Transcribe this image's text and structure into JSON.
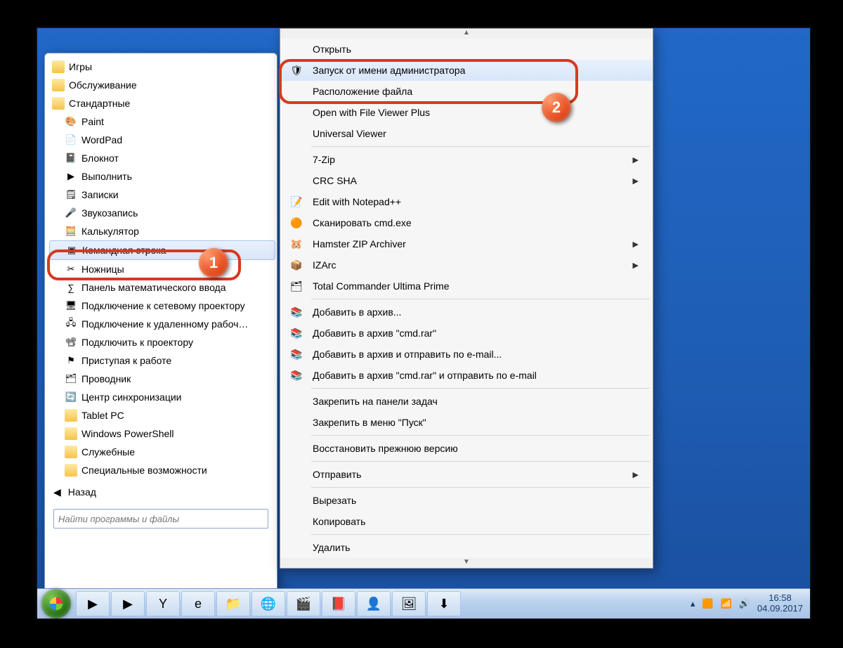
{
  "start_menu": {
    "folders": [
      "Игры",
      "Обслуживание",
      "Стандартные"
    ],
    "programs": [
      {
        "label": "Paint",
        "icon": "🎨"
      },
      {
        "label": "WordPad",
        "icon": "📄"
      },
      {
        "label": "Блокнот",
        "icon": "📓"
      },
      {
        "label": "Выполнить",
        "icon": "▶"
      },
      {
        "label": "Записки",
        "icon": "🗒"
      },
      {
        "label": "Звукозапись",
        "icon": "🎤"
      },
      {
        "label": "Калькулятор",
        "icon": "🧮"
      },
      {
        "label": "Командная строка",
        "icon": "▣",
        "selected": true
      },
      {
        "label": "Ножницы",
        "icon": "✂"
      },
      {
        "label": "Панель математического ввода",
        "icon": "∑"
      },
      {
        "label": "Подключение к сетевому проектору",
        "icon": "🖥"
      },
      {
        "label": "Подключение к удаленному рабоч…",
        "icon": "🖧"
      },
      {
        "label": "Подключить к проектору",
        "icon": "📽"
      },
      {
        "label": "Приступая к работе",
        "icon": "⚑"
      },
      {
        "label": "Проводник",
        "icon": "🗂"
      },
      {
        "label": "Центр синхронизации",
        "icon": "🔄"
      }
    ],
    "sub_folders": [
      "Tablet PC",
      "Windows PowerShell",
      "Служебные",
      "Специальные возможности"
    ],
    "back": "Назад",
    "search_placeholder": "Найти программы и файлы"
  },
  "context_menu": {
    "groups": [
      [
        {
          "label": "Открыть",
          "icon": ""
        },
        {
          "label": "Запуск от имени администратора",
          "icon": "🛡",
          "highlighted": true
        },
        {
          "label": "Расположение файла",
          "icon": ""
        },
        {
          "label": "Open with File Viewer Plus",
          "icon": ""
        },
        {
          "label": "Universal Viewer",
          "icon": ""
        }
      ],
      [
        {
          "label": "7-Zip",
          "icon": "",
          "submenu": true
        },
        {
          "label": "CRC SHA",
          "icon": "",
          "submenu": true
        },
        {
          "label": "Edit with Notepad++",
          "icon": "📝"
        },
        {
          "label": "Сканировать cmd.exe",
          "icon": "🟠"
        },
        {
          "label": "Hamster ZIP Archiver",
          "icon": "🐹",
          "submenu": true
        },
        {
          "label": "IZArc",
          "icon": "📦",
          "submenu": true
        },
        {
          "label": "Total Commander Ultima Prime",
          "icon": "🗂"
        }
      ],
      [
        {
          "label": "Добавить в архив...",
          "icon": "📚"
        },
        {
          "label": "Добавить в архив \"cmd.rar\"",
          "icon": "📚"
        },
        {
          "label": "Добавить в архив и отправить по e-mail...",
          "icon": "📚"
        },
        {
          "label": "Добавить в архив \"cmd.rar\" и отправить по e-mail",
          "icon": "📚"
        }
      ],
      [
        {
          "label": "Закрепить на панели задач",
          "icon": ""
        },
        {
          "label": "Закрепить в меню \"Пуск\"",
          "icon": ""
        }
      ],
      [
        {
          "label": "Восстановить прежнюю версию",
          "icon": ""
        }
      ],
      [
        {
          "label": "Отправить",
          "icon": "",
          "submenu": true
        }
      ],
      [
        {
          "label": "Вырезать",
          "icon": ""
        },
        {
          "label": "Копировать",
          "icon": ""
        }
      ],
      [
        {
          "label": "Удалить",
          "icon": ""
        }
      ]
    ]
  },
  "badges": {
    "one": "1",
    "two": "2"
  },
  "taskbar": {
    "buttons": [
      "▶",
      "▶",
      "Y",
      "e",
      "📁",
      "🌐",
      "🎬",
      "📕",
      "👤",
      "🖼",
      "⬇"
    ],
    "tray_icons": [
      "🟧",
      "📶",
      "🔊"
    ],
    "time": "16:58",
    "date": "04.09.2017"
  }
}
